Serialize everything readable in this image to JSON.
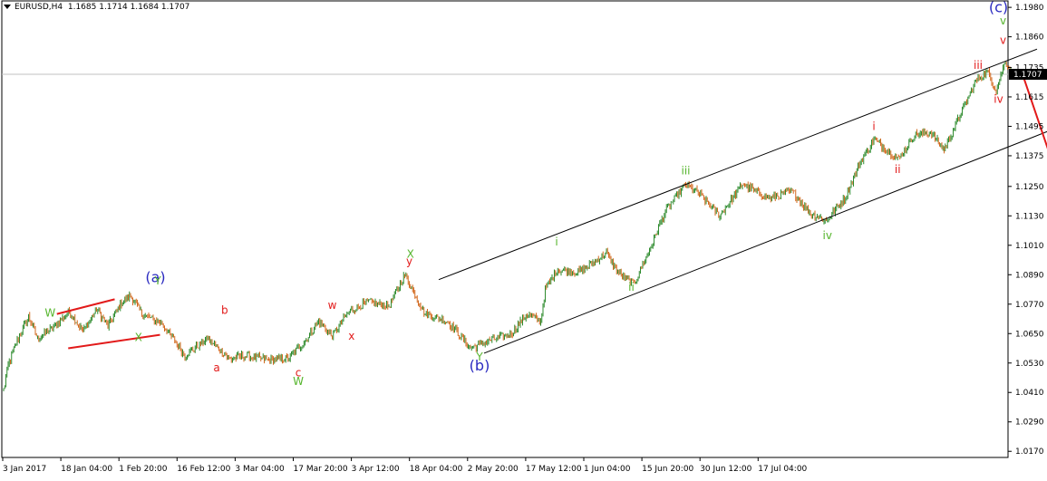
{
  "header": {
    "symbol": "EURUSD,H4",
    "ohlc": "1.1685 1.1714 1.1684 1.1707"
  },
  "colors": {
    "bull": "#2e8b2e",
    "bear": "#d2691e",
    "channel": "#000000",
    "red_lines": "#e21a1a",
    "wave_red": "#e21a1a",
    "wave_green": "#55b52c",
    "wave_blue": "#2a2ac0",
    "current_price_bg": "#000000"
  },
  "chart_data": {
    "type": "candlestick",
    "title": "",
    "xlabel": "",
    "ylabel": "",
    "ylim": [
      1.0145,
      1.201
    ],
    "yticks": [
      "1.1980",
      "1.1860",
      "1.1735",
      "1.1615",
      "1.1495",
      "1.1375",
      "1.1250",
      "1.1130",
      "1.1010",
      "1.0890",
      "1.0770",
      "1.0650",
      "1.0530",
      "1.0410",
      "1.0290",
      "1.0170"
    ],
    "current_price": "1.1707",
    "xticks": [
      "3 Jan 2017",
      "18 Jan 04:00",
      "1 Feb 20:00",
      "16 Feb 12:00",
      "3 Mar 04:00",
      "17 Mar 20:00",
      "3 Apr 12:00",
      "18 Apr 04:00",
      "2 May 20:00",
      "17 May 12:00",
      "1 Jun 04:00",
      "15 Jun 20:00",
      "30 Jun 12:00",
      "17 Jul 04:00"
    ],
    "price_path": [
      {
        "bar": 0,
        "price": 1.042
      },
      {
        "bar": 4,
        "price": 1.052
      },
      {
        "bar": 12,
        "price": 1.062
      },
      {
        "bar": 22,
        "price": 1.072
      },
      {
        "bar": 30,
        "price": 1.063
      },
      {
        "bar": 45,
        "price": 1.068
      },
      {
        "bar": 58,
        "price": 1.074
      },
      {
        "bar": 70,
        "price": 1.066
      },
      {
        "bar": 82,
        "price": 1.075
      },
      {
        "bar": 92,
        "price": 1.068
      },
      {
        "bar": 104,
        "price": 1.0775
      },
      {
        "bar": 112,
        "price": 1.0805
      },
      {
        "bar": 122,
        "price": 1.073
      },
      {
        "bar": 140,
        "price": 1.069
      },
      {
        "bar": 160,
        "price": 1.056
      },
      {
        "bar": 180,
        "price": 1.063
      },
      {
        "bar": 200,
        "price": 1.0545
      },
      {
        "bar": 212,
        "price": 1.056
      },
      {
        "bar": 236,
        "price": 1.054
      },
      {
        "bar": 252,
        "price": 1.055
      },
      {
        "bar": 266,
        "price": 1.062
      },
      {
        "bar": 278,
        "price": 1.07
      },
      {
        "bar": 290,
        "price": 1.064
      },
      {
        "bar": 305,
        "price": 1.074
      },
      {
        "bar": 322,
        "price": 1.078
      },
      {
        "bar": 340,
        "price": 1.076
      },
      {
        "bar": 354,
        "price": 1.089
      },
      {
        "bar": 372,
        "price": 1.073
      },
      {
        "bar": 392,
        "price": 1.07
      },
      {
        "bar": 412,
        "price": 1.059
      },
      {
        "bar": 428,
        "price": 1.062
      },
      {
        "bar": 448,
        "price": 1.065
      },
      {
        "bar": 462,
        "price": 1.073
      },
      {
        "bar": 474,
        "price": 1.07
      },
      {
        "bar": 478,
        "price": 1.083
      },
      {
        "bar": 488,
        "price": 1.091
      },
      {
        "bar": 508,
        "price": 1.09
      },
      {
        "bar": 532,
        "price": 1.098
      },
      {
        "bar": 542,
        "price": 1.09
      },
      {
        "bar": 556,
        "price": 1.085
      },
      {
        "bar": 570,
        "price": 1.099
      },
      {
        "bar": 584,
        "price": 1.115
      },
      {
        "bar": 602,
        "price": 1.126
      },
      {
        "bar": 614,
        "price": 1.122
      },
      {
        "bar": 632,
        "price": 1.113
      },
      {
        "bar": 652,
        "price": 1.126
      },
      {
        "bar": 676,
        "price": 1.12
      },
      {
        "bar": 696,
        "price": 1.123
      },
      {
        "bar": 712,
        "price": 1.114
      },
      {
        "bar": 726,
        "price": 1.111
      },
      {
        "bar": 742,
        "price": 1.12
      },
      {
        "bar": 756,
        "price": 1.135
      },
      {
        "bar": 768,
        "price": 1.144
      },
      {
        "bar": 790,
        "price": 1.136
      },
      {
        "bar": 804,
        "price": 1.146
      },
      {
        "bar": 818,
        "price": 1.147
      },
      {
        "bar": 830,
        "price": 1.14
      },
      {
        "bar": 846,
        "price": 1.156
      },
      {
        "bar": 858,
        "price": 1.168
      },
      {
        "bar": 868,
        "price": 1.172
      },
      {
        "bar": 876,
        "price": 1.164
      },
      {
        "bar": 884,
        "price": 1.176
      },
      {
        "bar": 890,
        "price": 1.1707
      }
    ],
    "annotations": [
      {
        "text": "(a)",
        "bar": 134,
        "price": 1.086,
        "color": "blue"
      },
      {
        "text": "(b)",
        "bar": 420,
        "price": 1.05,
        "color": "blue"
      },
      {
        "text": "(c)",
        "bar": 878,
        "price": 1.196,
        "color": "blue"
      },
      {
        "text": "W",
        "bar": 41,
        "price": 1.072,
        "color": "green"
      },
      {
        "text": "X",
        "bar": 119,
        "price": 1.062,
        "color": "green"
      },
      {
        "text": "Y",
        "bar": 136,
        "price": 1.085,
        "color": "green"
      },
      {
        "text": "b",
        "bar": 195,
        "price": 1.073,
        "color": "red"
      },
      {
        "text": "a",
        "bar": 188,
        "price": 1.0495,
        "color": "red"
      },
      {
        "text": "c",
        "bar": 260,
        "price": 1.0475,
        "color": "red"
      },
      {
        "text": "W",
        "bar": 260,
        "price": 1.044,
        "color": "green"
      },
      {
        "text": "w",
        "bar": 290,
        "price": 1.075,
        "color": "red"
      },
      {
        "text": "x",
        "bar": 307,
        "price": 1.0625,
        "color": "red"
      },
      {
        "text": "X",
        "bar": 359,
        "price": 1.096,
        "color": "green"
      },
      {
        "text": "y",
        "bar": 358,
        "price": 1.093,
        "color": "red"
      },
      {
        "text": "Y",
        "bar": 420,
        "price": 1.054,
        "color": "green"
      },
      {
        "text": "i",
        "bar": 488,
        "price": 1.101,
        "color": "green"
      },
      {
        "text": "ii",
        "bar": 554,
        "price": 1.0825,
        "color": "green"
      },
      {
        "text": "iii",
        "bar": 602,
        "price": 1.13,
        "color": "green"
      },
      {
        "text": "iv",
        "bar": 727,
        "price": 1.1035,
        "color": "green"
      },
      {
        "text": "v",
        "bar": 882,
        "price": 1.191,
        "color": "green"
      },
      {
        "text": "i",
        "bar": 768,
        "price": 1.148,
        "color": "red"
      },
      {
        "text": "ii",
        "bar": 789,
        "price": 1.1305,
        "color": "red"
      },
      {
        "text": "iii",
        "bar": 860,
        "price": 1.173,
        "color": "red"
      },
      {
        "text": "iv",
        "bar": 878,
        "price": 1.159,
        "color": "red"
      },
      {
        "text": "v",
        "bar": 882,
        "price": 1.183,
        "color": "red"
      }
    ],
    "channel_upper": [
      {
        "bar": 384,
        "price": 1.087
      },
      {
        "bar": 912,
        "price": 1.181
      }
    ],
    "channel_lower": [
      {
        "bar": 424,
        "price": 1.057
      },
      {
        "bar": 952,
        "price": 1.153
      }
    ],
    "red_trend_lines": [
      [
        {
          "bar": 47,
          "price": 1.073
        },
        {
          "bar": 98,
          "price": 1.079
        }
      ],
      [
        {
          "bar": 57,
          "price": 1.059
        },
        {
          "bar": 138,
          "price": 1.0645
        }
      ],
      [
        {
          "bar": 899,
          "price": 1.171
        },
        {
          "bar": 924,
          "price": 1.137
        }
      ]
    ]
  }
}
